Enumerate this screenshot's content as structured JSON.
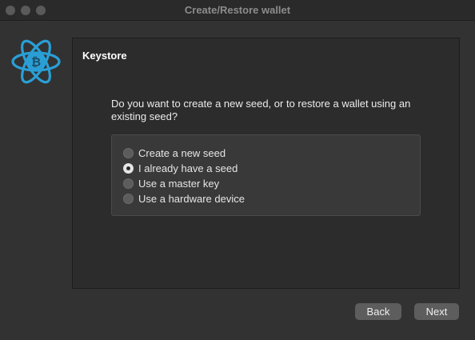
{
  "window": {
    "title": "Create/Restore wallet"
  },
  "logo": {
    "icon": "electrum-bitcoin-atom-logo",
    "color": "#2a9fd6"
  },
  "panel": {
    "title": "Keystore",
    "question": "Do you want to create a new seed, or to restore a wallet using an existing seed?",
    "options": [
      {
        "label": "Create a new seed",
        "selected": false
      },
      {
        "label": "I already have a seed",
        "selected": true
      },
      {
        "label": "Use a master key",
        "selected": false
      },
      {
        "label": "Use a hardware device",
        "selected": false
      }
    ]
  },
  "buttons": {
    "back_label": "Back",
    "next_label": "Next"
  }
}
